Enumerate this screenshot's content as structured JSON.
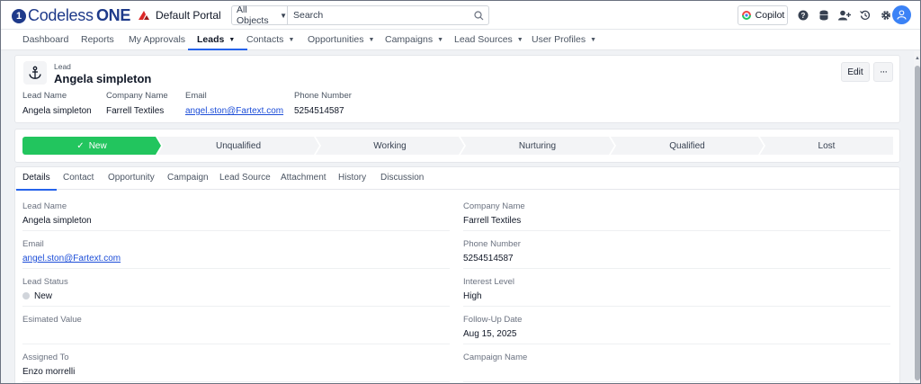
{
  "header": {
    "brand_prefix": "Codeless",
    "brand_suffix": "ONE",
    "portal": "Default Portal",
    "search_scope": "All Objects",
    "search_placeholder": "Search",
    "copilot": "Copilot",
    "colors": {
      "brand": "#1e3a8a",
      "accent": "#2563eb",
      "success": "#22c55e"
    }
  },
  "nav": {
    "items": [
      {
        "label": "Dashboard"
      },
      {
        "label": "Reports"
      },
      {
        "label": "My Approvals"
      },
      {
        "label": "Leads"
      },
      {
        "label": "Contacts"
      },
      {
        "label": "Opportunities"
      },
      {
        "label": "Campaigns"
      },
      {
        "label": "Lead Sources"
      },
      {
        "label": "User Profiles"
      }
    ]
  },
  "record": {
    "type": "Lead",
    "title": "Angela simpleton",
    "edit": "Edit",
    "more": "···",
    "highlights": [
      {
        "label": "Lead Name",
        "value": "Angela simpleton"
      },
      {
        "label": "Company Name",
        "value": "Farrell Textiles"
      },
      {
        "label": "Email",
        "value": "angel.ston@Fartext.com"
      },
      {
        "label": "Phone Number",
        "value": "5254514587"
      }
    ]
  },
  "stages": [
    "New",
    "Unqualified",
    "Working",
    "Nurturing",
    "Qualified",
    "Lost"
  ],
  "tabs": [
    "Details",
    "Contact",
    "Opportunity",
    "Campaign",
    "Lead Source",
    "Attachment",
    "History",
    "Discussion"
  ],
  "details": {
    "left": [
      {
        "label": "Lead Name",
        "value": "Angela simpleton"
      },
      {
        "label": "Email",
        "value": "angel.ston@Fartext.com"
      },
      {
        "label": "Lead Status",
        "value": "New"
      },
      {
        "label": "Esimated Value",
        "value": ""
      },
      {
        "label": "Assigned To",
        "value": "Enzo morrelli"
      }
    ],
    "right": [
      {
        "label": "Company Name",
        "value": "Farrell Textiles"
      },
      {
        "label": "Phone Number",
        "value": "5254514587"
      },
      {
        "label": "Interest Level",
        "value": "High"
      },
      {
        "label": "Follow-Up Date",
        "value": "Aug 15, 2025"
      },
      {
        "label": "Campaign Name",
        "value": ""
      }
    ]
  }
}
